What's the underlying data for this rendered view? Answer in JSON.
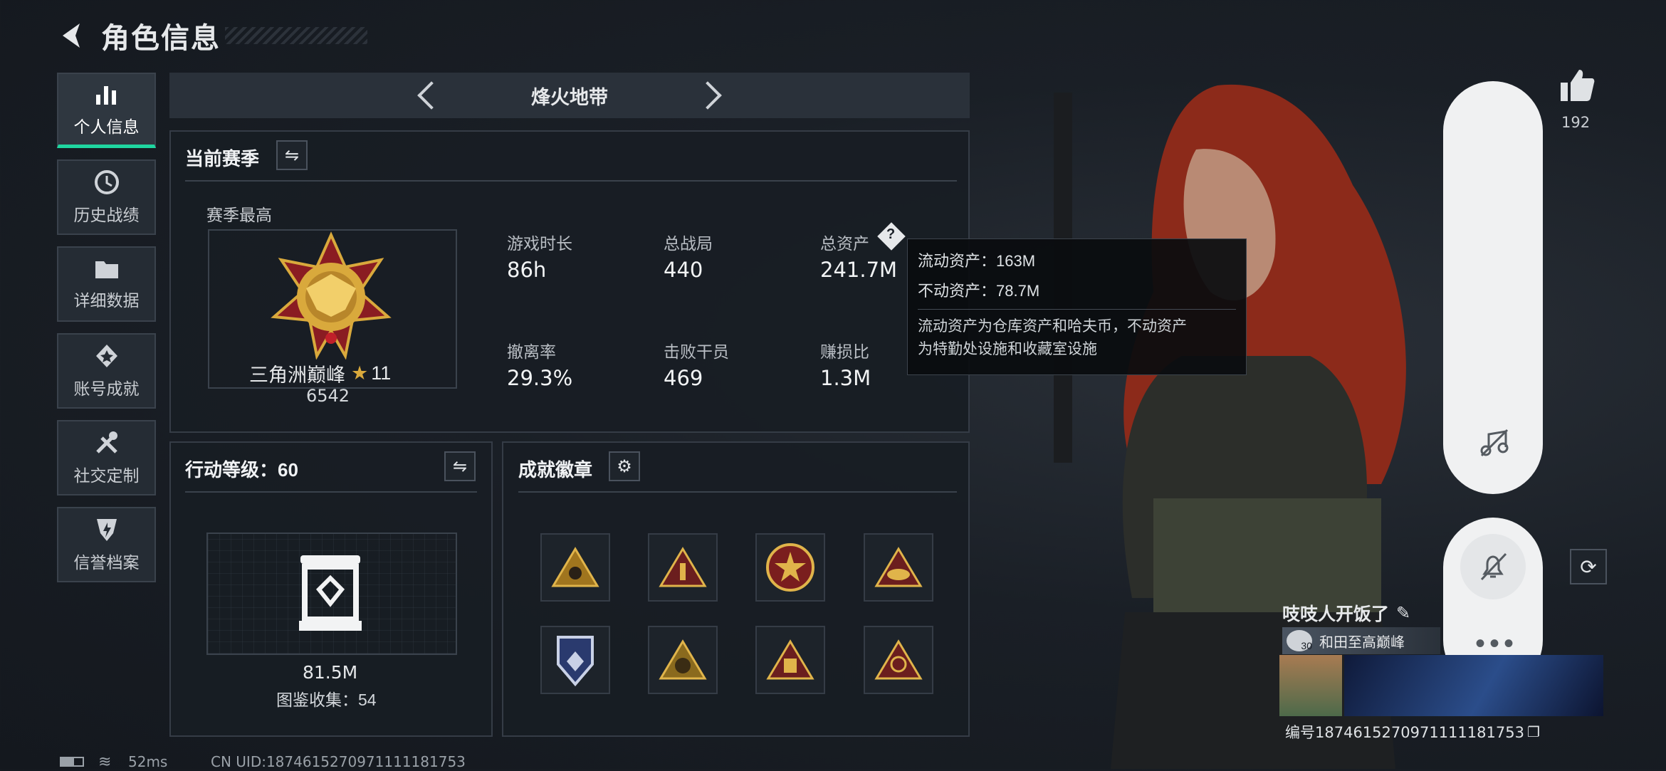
{
  "header": {
    "title": "角色信息"
  },
  "nav": [
    {
      "label": "个人信息",
      "icon": "bar-chart-icon",
      "active": true
    },
    {
      "label": "历史战绩",
      "icon": "history-clock-icon"
    },
    {
      "label": "详细数据",
      "icon": "folder-icon"
    },
    {
      "label": "账号成就",
      "icon": "achievement-icon"
    },
    {
      "label": "社交定制",
      "icon": "tools-icon"
    },
    {
      "label": "信誉档案",
      "icon": "shield-bolt-icon"
    }
  ],
  "mode": {
    "name": "烽火地带"
  },
  "season": {
    "title": "当前赛季",
    "best_label": "赛季最高",
    "rank_name": "三角洲巅峰",
    "rank_stars": "11",
    "rank_score": "6542",
    "stats": [
      {
        "label": "游戏时长",
        "value": "86h"
      },
      {
        "label": "总战局",
        "value": "440"
      },
      {
        "label": "总资产",
        "value": "241.7M"
      },
      {
        "label": "撤离率",
        "value": "29.3%"
      },
      {
        "label": "击败干员",
        "value": "469"
      },
      {
        "label": "赚损比",
        "value": "1.3M"
      }
    ]
  },
  "tooltip": {
    "liquid": "流动资产：163M",
    "fixed": "不动资产：78.7M",
    "note_line1": "流动资产为仓库资产和哈夫币，不动资产",
    "note_line2": "为特勤处设施和收藏室设施"
  },
  "action_level": {
    "title": "行动等级：60",
    "value": "81.5M",
    "collection": "图鉴收集：54"
  },
  "badges": {
    "title": "成就徽章"
  },
  "social": {
    "likes": "192",
    "player_name": "吱吱人开饭了",
    "tag_level": "30",
    "tag_text": "和田至高巅峰",
    "serial": "编号1874615270971111181753"
  },
  "footer": {
    "ping": "52ms",
    "uid": "CN UID:1874615270971111181753"
  },
  "colors": {
    "accent": "#1fd6a0",
    "gold": "#d9a93c"
  }
}
